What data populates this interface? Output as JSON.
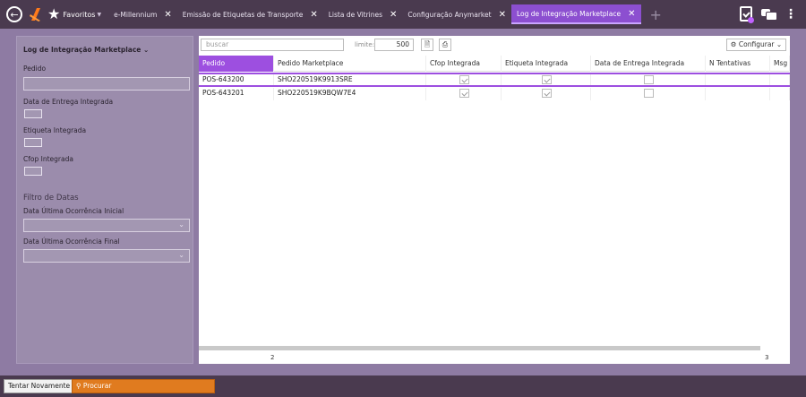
{
  "topbar": {
    "favorites_label": "Favoritos",
    "tabs": [
      {
        "label": "e-Millennium"
      },
      {
        "label": "Emissão de Etiquetas de Transporte"
      },
      {
        "label": "Lista de Vitrines"
      },
      {
        "label": "Configuração Anymarket"
      },
      {
        "label": "Log de Integração Marketplace"
      }
    ],
    "close_glyph": "✕",
    "add_glyph": "+"
  },
  "filters": {
    "title": "Log de Integração Marketplace",
    "pedido_label": "Pedido",
    "data_entrega_label": "Data de Entrega Integrada",
    "etiqueta_label": "Etiqueta Integrada",
    "cfop_label": "Cfop Integrada",
    "filtro_datas_label": "Filtro de Datas",
    "data_inicial_label": "Data Última Ocorrência Inicial",
    "data_final_label": "Data Última Ocorrência Final"
  },
  "toolbar": {
    "search_placeholder": "buscar",
    "limite_label": "limite:",
    "limite_value": "500",
    "config_label": "Configurar"
  },
  "table": {
    "columns": [
      "Pedido",
      "Pedido Marketplace",
      "Cfop Integrada",
      "Etiqueta Integrada",
      "Data de Entrega Integrada",
      "N Tentativas",
      "Msg"
    ],
    "rows": [
      {
        "pedido": "POS-643200",
        "pedido_marketplace": "SHO220519K9913SRE",
        "cfop": true,
        "etiqueta": true,
        "data_entrega": false
      },
      {
        "pedido": "POS-643201",
        "pedido_marketplace": "SHO220519K9BQW7E4",
        "cfop": true,
        "etiqueta": true,
        "data_entrega": false
      }
    ],
    "footer_count_left": "2",
    "footer_count_right": "3"
  },
  "bottombar": {
    "retry_label": "Tentar Novamente",
    "search_label": "Procurar"
  },
  "colors": {
    "topbar": "#4a3a4f",
    "accent": "#9d4fe0",
    "search_button": "#e07b1f"
  }
}
